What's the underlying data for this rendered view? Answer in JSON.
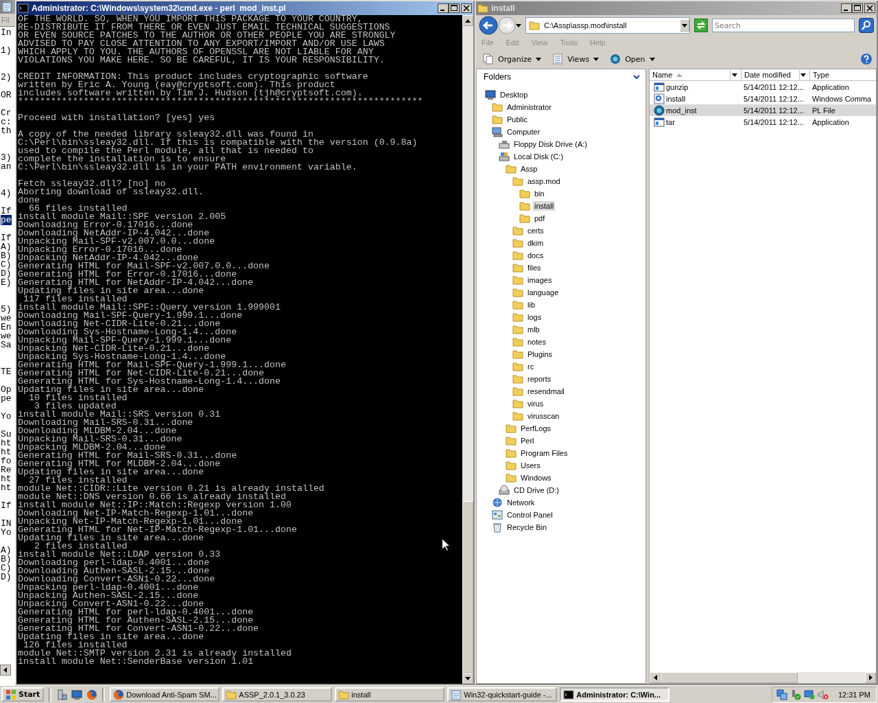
{
  "notepad_window": {
    "menu": "Fil",
    "lines": [
      {
        "kind": "line",
        "text": "In",
        "selected": false
      },
      {
        "kind": "blank"
      },
      {
        "kind": "line",
        "text": "1)",
        "selected": false
      },
      {
        "kind": "blank"
      },
      {
        "kind": "blank"
      },
      {
        "kind": "line",
        "text": "2)",
        "selected": false
      },
      {
        "kind": "blank"
      },
      {
        "kind": "line",
        "text": "OR",
        "selected": false
      },
      {
        "kind": "blank"
      },
      {
        "kind": "line",
        "text": "Cr",
        "selected": false
      },
      {
        "kind": "line",
        "text": "c:",
        "selected": false
      },
      {
        "kind": "line",
        "text": "th",
        "selected": false
      },
      {
        "kind": "blank"
      },
      {
        "kind": "blank"
      },
      {
        "kind": "line",
        "text": "3)",
        "selected": false
      },
      {
        "kind": "line",
        "text": "an",
        "selected": false
      },
      {
        "kind": "blank"
      },
      {
        "kind": "blank"
      },
      {
        "kind": "line",
        "text": "4)",
        "selected": false
      },
      {
        "kind": "blank"
      },
      {
        "kind": "line",
        "text": "If",
        "selected": false
      },
      {
        "kind": "line",
        "text": "pe",
        "selected": true
      },
      {
        "kind": "blank"
      },
      {
        "kind": "line",
        "text": "If",
        "selected": false
      },
      {
        "kind": "line",
        "text": "A)",
        "selected": false
      },
      {
        "kind": "line",
        "text": "B)",
        "selected": false
      },
      {
        "kind": "line",
        "text": "C)",
        "selected": false
      },
      {
        "kind": "line",
        "text": "D)",
        "selected": false
      },
      {
        "kind": "line",
        "text": "E)",
        "selected": false
      },
      {
        "kind": "blank"
      },
      {
        "kind": "blank"
      },
      {
        "kind": "line",
        "text": "5)",
        "selected": false
      },
      {
        "kind": "line",
        "text": "we",
        "selected": false
      },
      {
        "kind": "line",
        "text": "En",
        "selected": false
      },
      {
        "kind": "line",
        "text": "we",
        "selected": false
      },
      {
        "kind": "line",
        "text": "Sa",
        "selected": false
      },
      {
        "kind": "blank"
      },
      {
        "kind": "blank"
      },
      {
        "kind": "line",
        "text": "TE",
        "selected": false
      },
      {
        "kind": "blank"
      },
      {
        "kind": "line",
        "text": "Op",
        "selected": false
      },
      {
        "kind": "line",
        "text": "pe",
        "selected": false
      },
      {
        "kind": "blank"
      },
      {
        "kind": "line",
        "text": "Yo",
        "selected": false
      },
      {
        "kind": "blank"
      },
      {
        "kind": "line",
        "text": "Su",
        "selected": false
      },
      {
        "kind": "line",
        "text": "ht",
        "selected": false
      },
      {
        "kind": "line",
        "text": "ht",
        "selected": false
      },
      {
        "kind": "line",
        "text": "fo",
        "selected": false
      },
      {
        "kind": "line",
        "text": "Re",
        "selected": false
      },
      {
        "kind": "line",
        "text": "ht",
        "selected": false
      },
      {
        "kind": "line",
        "text": "ht",
        "selected": false
      },
      {
        "kind": "blank"
      },
      {
        "kind": "line",
        "text": "If",
        "selected": false
      },
      {
        "kind": "blank"
      },
      {
        "kind": "line",
        "text": "IN",
        "selected": false
      },
      {
        "kind": "line",
        "text": "Yo",
        "selected": false
      },
      {
        "kind": "blank"
      },
      {
        "kind": "line",
        "text": "A)",
        "selected": false
      },
      {
        "kind": "line",
        "text": "B)",
        "selected": false
      },
      {
        "kind": "line",
        "text": "C)",
        "selected": false
      },
      {
        "kind": "line",
        "text": "D)",
        "selected": false
      }
    ]
  },
  "cmd_window": {
    "title": "Administrator: C:\\Windows\\system32\\cmd.exe - perl  mod_inst.pl",
    "active": true,
    "output": "OF THE WORLD. SO, WHEN YOU IMPORT THIS PACKAGE TO YOUR COUNTRY,\nRE-DISTRIBUTE IT FROM THERE OR EVEN JUST EMAIL TECHNICAL SUGGESTIONS\nOR EVEN SOURCE PATCHES TO THE AUTHOR OR OTHER PEOPLE YOU ARE STRONGLY\nADVISED TO PAY CLOSE ATTENTION TO ANY EXPORT/IMPORT AND/OR USE LAWS\nWHICH APPLY TO YOU. THE AUTHORS OF OPENSSL ARE NOT LIABLE FOR ANY\nVIOLATIONS YOU MAKE HERE. SO BE CAREFUL, IT IS YOUR RESPONSIBILITY.\n\nCREDIT INFORMATION: This product includes cryptographic software\nwritten by Eric A. Young (eay@cryptsoft.com). This product\nincludes software written by Tim J. Hudson (tjh@cryptsoft.com).\n**************************************************************************\n\nProceed with installation? [yes] yes\n\nA copy of the needed library ssleay32.dll was found in\nC:\\Perl\\bin\\ssleay32.dll. If this is compatible with the version (0.9.8a)\nused to compile the Perl module, all that is needed to\ncomplete the installation is to ensure\nC:\\Perl\\bin\\ssleay32.dll is in your PATH environment variable.\n\nFetch ssleay32.dll? [no] no\nAborting download of ssleay32.dll.\ndone\n  66 files installed\ninstall module Mail::SPF version 2.005\nDownloading Error-0.17016...done\nDownloading NetAddr-IP-4.042...done\nUnpacking Mail-SPF-v2.007.0.0...done\nUnpacking Error-0.17016...done\nUnpacking NetAddr-IP-4.042...done\nGenerating HTML for Mail-SPF-v2.007.0.0...done\nGenerating HTML for Error-0.17016...done\nGenerating HTML for NetAddr-IP-4.042...done\nUpdating files in site area...done\n 117 files installed\ninstall module Mail::SPF::Query version 1.999001\nDownloading Mail-SPF-Query-1.999.1...done\nDownloading Net-CIDR-Lite-0.21...done\nDownloading Sys-Hostname-Long-1.4...done\nUnpacking Mail-SPF-Query-1.999.1...done\nUnpacking Net-CIDR-Lite-0.21...done\nUnpacking Sys-Hostname-Long-1.4...done\nGenerating HTML for Mail-SPF-Query-1.999.1...done\nGenerating HTML for Net-CIDR-Lite-0.21...done\nGenerating HTML for Sys-Hostname-Long-1.4...done\nUpdating files in site area...done\n  10 files installed\n   3 files updated\ninstall module Mail::SRS version 0.31\nDownloading Mail-SRS-0.31...done\nDownloading MLDBM-2.04...done\nUnpacking Mail-SRS-0.31...done\nUnpacking MLDBM-2.04...done\nGenerating HTML for Mail-SRS-0.31...done\nGenerating HTML for MLDBM-2.04...done\nUpdating files in site area...done\n  27 files installed\nmodule Net::CIDR::Lite version 0.21 is already installed\nmodule Net::DNS version 0.66 is already installed\ninstall module Net::IP::Match::Regexp version 1.00\nDownloading Net-IP-Match-Regexp-1.01...done\nUnpacking Net-IP-Match-Regexp-1.01...done\nGenerating HTML for Net-IP-Match-Regexp-1.01...done\nUpdating files in site area...done\n   2 files installed\ninstall module Net::LDAP version 0.33\nDownloading perl-ldap-0.4001...done\nDownloading Authen-SASL-2.15...done\nDownloading Convert-ASN1-0.22...done\nUnpacking perl-ldap-0.4001...done\nUnpacking Authen-SASL-2.15...done\nUnpacking Convert-ASN1-0.22...done\nGenerating HTML for perl-ldap-0.4001...done\nGenerating HTML for Authen-SASL-2.15...done\nGenerating HTML for Convert-ASN1-0.22...done\nUpdating files in site area...done\n 126 files installed\nmodule Net::SMTP version 2.31 is already installed\ninstall module Net::SenderBase version 1.01"
  },
  "explorer_window": {
    "title": "install",
    "active": false,
    "address": "C:\\Assp\\assp.mod\\install",
    "search": {
      "placeholder": "Search"
    },
    "menu": [
      "File",
      "Edit",
      "View",
      "Tools",
      "Help"
    ],
    "toolbar": [
      {
        "label": "Organize",
        "kind": "organize"
      },
      {
        "label": "Views",
        "kind": "views"
      },
      {
        "label": "Open",
        "kind": "open"
      }
    ],
    "folders_label": "Folders",
    "tree": [
      {
        "label": "Desktop",
        "kind": "desktop",
        "selected": false,
        "children": [
          {
            "label": "Administrator",
            "kind": "folder",
            "selected": false
          },
          {
            "label": "Public",
            "kind": "folder",
            "selected": false
          },
          {
            "label": "Computer",
            "kind": "computer",
            "selected": false,
            "children": [
              {
                "label": "Floppy Disk Drive (A:)",
                "kind": "floppy",
                "selected": false
              },
              {
                "label": "Local Disk (C:)",
                "kind": "disk",
                "selected": false,
                "children": [
                  {
                    "label": "Assp",
                    "kind": "folder",
                    "selected": false,
                    "children": [
                      {
                        "label": "assp.mod",
                        "kind": "folder",
                        "selected": false,
                        "children": [
                          {
                            "label": "bin",
                            "kind": "folder",
                            "selected": false
                          },
                          {
                            "label": "install",
                            "kind": "folder",
                            "selected": true
                          },
                          {
                            "label": "pdf",
                            "kind": "folder",
                            "selected": false
                          }
                        ]
                      },
                      {
                        "label": "certs",
                        "kind": "folder",
                        "selected": false
                      },
                      {
                        "label": "dkim",
                        "kind": "folder",
                        "selected": false
                      },
                      {
                        "label": "docs",
                        "kind": "folder",
                        "selected": false
                      },
                      {
                        "label": "files",
                        "kind": "folder",
                        "selected": false
                      },
                      {
                        "label": "images",
                        "kind": "folder",
                        "selected": false
                      },
                      {
                        "label": "language",
                        "kind": "folder",
                        "selected": false
                      },
                      {
                        "label": "lib",
                        "kind": "folder",
                        "selected": false
                      },
                      {
                        "label": "logs",
                        "kind": "folder",
                        "selected": false
                      },
                      {
                        "label": "mlb",
                        "kind": "folder",
                        "selected": false
                      },
                      {
                        "label": "notes",
                        "kind": "folder",
                        "selected": false
                      },
                      {
                        "label": "Plugins",
                        "kind": "folder",
                        "selected": false
                      },
                      {
                        "label": "rc",
                        "kind": "folder",
                        "selected": false
                      },
                      {
                        "label": "reports",
                        "kind": "folder",
                        "selected": false
                      },
                      {
                        "label": "resendmail",
                        "kind": "folder",
                        "selected": false
                      },
                      {
                        "label": "virus",
                        "kind": "folder",
                        "selected": false
                      },
                      {
                        "label": "virusscan",
                        "kind": "folder",
                        "selected": false
                      }
                    ]
                  },
                  {
                    "label": "PerfLogs",
                    "kind": "folder",
                    "selected": false
                  },
                  {
                    "label": "Perl",
                    "kind": "folder",
                    "selected": false
                  },
                  {
                    "label": "Program Files",
                    "kind": "folder",
                    "selected": false
                  },
                  {
                    "label": "Users",
                    "kind": "folder",
                    "selected": false
                  },
                  {
                    "label": "Windows",
                    "kind": "folder",
                    "selected": false
                  }
                ]
              },
              {
                "label": "CD Drive (D:)",
                "kind": "cd",
                "selected": false
              }
            ]
          },
          {
            "label": "Network",
            "kind": "network",
            "selected": false
          },
          {
            "label": "Control Panel",
            "kind": "control-panel",
            "selected": false
          },
          {
            "label": "Recycle Bin",
            "kind": "recycle",
            "selected": false
          }
        ]
      }
    ],
    "columns": [
      "Name",
      "Date modified",
      "Type"
    ],
    "files": [
      {
        "name": "gunzip",
        "date": "5/14/2011 12:12...",
        "type": "Application",
        "kind": "app",
        "selected": false
      },
      {
        "name": "install",
        "date": "5/14/2011 12:12...",
        "type": "Windows Comma",
        "kind": "script",
        "selected": false
      },
      {
        "name": "mod_inst",
        "date": "5/14/2011 12:12...",
        "type": "PL File",
        "kind": "perl",
        "selected": true
      },
      {
        "name": "tar",
        "date": "5/14/2011 12:12...",
        "type": "Application",
        "kind": "app",
        "selected": false
      }
    ]
  },
  "taskbar": {
    "start": "Start",
    "quick_launch": [
      {
        "kind": "server"
      },
      {
        "kind": "desktop"
      },
      {
        "kind": "browser"
      }
    ],
    "tasks": [
      {
        "label": "Download Anti-Spam SM...",
        "kind": "browser",
        "selected": false
      },
      {
        "label": "ASSP_2.0.1_3.0.23",
        "kind": "folder",
        "selected": false
      },
      {
        "label": "install",
        "kind": "folder",
        "selected": false
      },
      {
        "label": "Win32-quickstart-guide -...",
        "kind": "notepad",
        "selected": false
      },
      {
        "label": "Administrator: C:\\Win...",
        "kind": "console",
        "selected": true
      }
    ],
    "clock": "12:31 PM"
  }
}
